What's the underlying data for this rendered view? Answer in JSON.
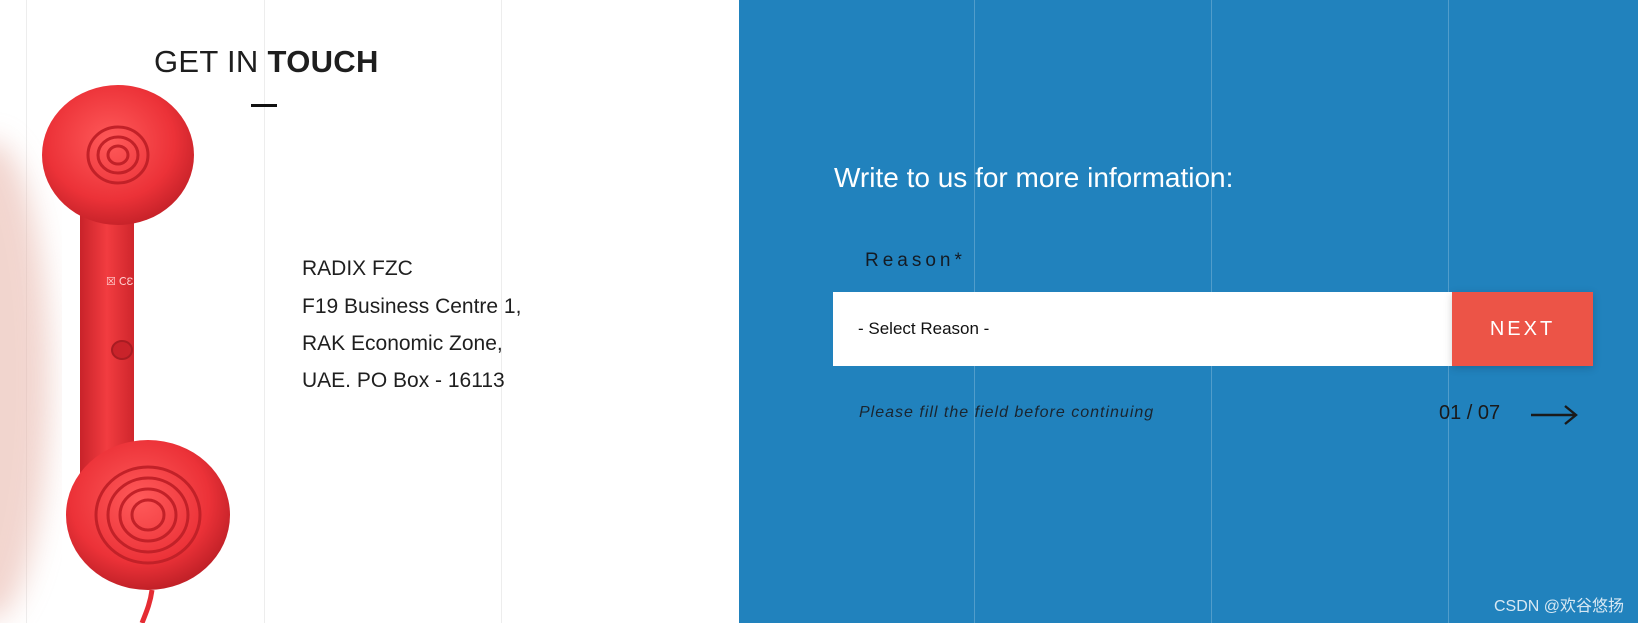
{
  "contact": {
    "heading_light": "GET IN",
    "heading_strong": "TOUCH",
    "company": "RADIX FZC",
    "address_lines": [
      "F19 Business Centre 1,",
      "RAK Economic Zone,",
      "UAE. PO Box - 16113"
    ],
    "image_icon": "telephone-handset"
  },
  "form": {
    "title": "Write to us for more information:",
    "field_label": "Reason*",
    "select_value": "- Select Reason -",
    "next_label": "NEXT",
    "hint": "Please fill the field before continuing",
    "counter": "01 / 07",
    "arrow_icon": "arrow-right"
  },
  "watermark": "CSDN @欢谷悠扬",
  "colors": {
    "panel_blue": "#2182bd",
    "next_button": "#ec5447",
    "phone_red": "#ec3238"
  }
}
